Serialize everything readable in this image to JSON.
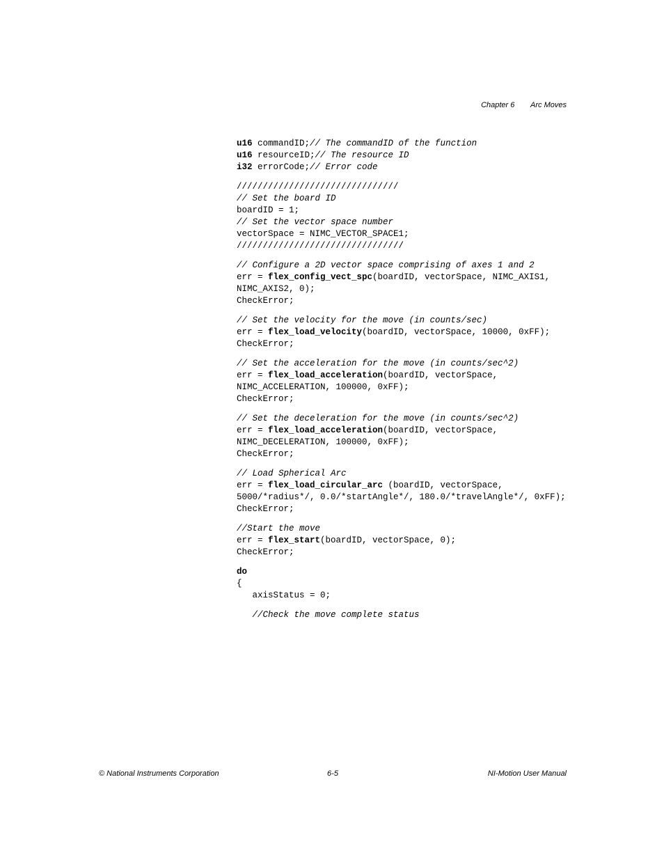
{
  "header": {
    "chapter": "Chapter 6",
    "title": "Arc Moves"
  },
  "code": {
    "line1_kw": "u16",
    "line1_text": " commandID;",
    "line1_comment": "// The commandID of the function",
    "line2_kw": "u16",
    "line2_text": " resourceID;",
    "line2_comment": "// The resource ID",
    "line3_kw": "i32",
    "line3_text": " errorCode;",
    "line3_comment": "// Error code",
    "slashes1": "///////////////////////////////",
    "comment_board": "// Set the board ID",
    "board_line": "boardID = 1;",
    "comment_vector": "// Set the vector space number",
    "vector_line": "vectorSpace = NIMC_VECTOR_SPACE1;",
    "slashes2": "////////////////////////////////",
    "comment_config": "// Configure a 2D vector space comprising of axes 1 and 2",
    "err_eq": "err = ",
    "fn_config": "flex_config_vect_spc",
    "config_args": "(boardID, vectorSpace, NIMC_AXIS1, NIMC_AXIS2, 0);",
    "check": "CheckError;",
    "comment_vel": "// Set the velocity for the move (in counts/sec)",
    "fn_vel": "flex_load_velocity",
    "vel_args": "(boardID, vectorSpace, 10000, 0xFF);",
    "comment_acc": "// Set the acceleration for the move (in counts/sec^2)",
    "fn_acc": "flex_load_acceleration",
    "acc_args": "(boardID, vectorSpace, NIMC_ACCELERATION, 100000, 0xFF);",
    "comment_dec": "// Set the deceleration for the move (in counts/sec^2)",
    "dec_args": "(boardID, vectorSpace, NIMC_DECELERATION, 100000, 0xFF);",
    "comment_arc": "// Load Spherical Arc",
    "fn_arc": "flex_load_circular_arc",
    "arc_args": " (boardID, vectorSpace, 5000/*radius*/, 0.0/*startAngle*/, 180.0/*travelAngle*/, 0xFF);",
    "comment_start": "//Start the move",
    "fn_start": "flex_start",
    "start_args": "(boardID, vectorSpace, 0);",
    "do_kw": "do",
    "brace": "{",
    "axis_line": "axisStatus = 0;",
    "comment_check": "//Check the move complete status",
    "indent": "   "
  },
  "footer": {
    "left": "© National Instruments Corporation",
    "center": "6-5",
    "right": "NI-Motion User Manual"
  }
}
